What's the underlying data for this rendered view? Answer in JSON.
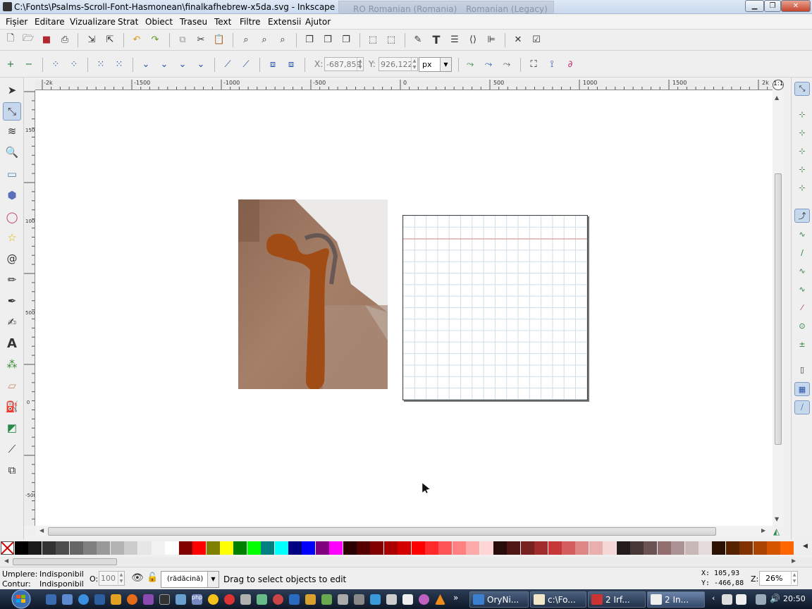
{
  "window": {
    "title": "C:\\Fonts\\Psalms-Scroll-Font-Hasmonean\\finalkafhebrew-x5da.svg - Inkscape",
    "lang_primary": "RO Romanian (Romania)",
    "lang_secondary": "Romanian (Legacy)",
    "minimize": "▁",
    "maximize": "❐",
    "close": "✕"
  },
  "menu": [
    "Fișier",
    "Editare",
    "Vizualizare",
    "Strat",
    "Obiect",
    "Traseu",
    "Text",
    "Filtre",
    "Extensii",
    "Ajutor"
  ],
  "node_toolbar": {
    "x_label": "X:",
    "x_value": "-687,859",
    "y_label": "Y:",
    "y_value": "926,122",
    "unit": "px"
  },
  "ruler_h": [
    "-2k",
    "-1500",
    "-1000",
    "-500",
    "0",
    "500",
    "1000",
    "1500",
    "2k"
  ],
  "ruler_v": [
    "1500",
    "1000",
    "500",
    "0",
    "-500"
  ],
  "palette_colors": [
    "#000000",
    "#1a1a1a",
    "#333333",
    "#4d4d4d",
    "#666666",
    "#808080",
    "#999999",
    "#b3b3b3",
    "#cccccc",
    "#e6e6e6",
    "#f2f2f2",
    "#ffffff",
    "#800000",
    "#ff0000",
    "#808000",
    "#ffff00",
    "#008000",
    "#00ff00",
    "#008080",
    "#00ffff",
    "#000080",
    "#0000ff",
    "#800080",
    "#ff00ff",
    "#2b0000",
    "#550000",
    "#800000",
    "#aa0000",
    "#d40000",
    "#ff0000",
    "#ff2a2a",
    "#ff5555",
    "#ff8080",
    "#ffaaaa",
    "#ffd5d5",
    "#280b0b",
    "#501616",
    "#782121",
    "#a02c2c",
    "#c83737",
    "#d35f5f",
    "#de8787",
    "#e9afaf",
    "#f4d7d7",
    "#241c1c",
    "#483737",
    "#6c5353",
    "#916f6f",
    "#ac9393",
    "#c8b7b7",
    "#e3dbdb",
    "#2b1100",
    "#552200",
    "#803300",
    "#aa4400",
    "#d45500",
    "#ff6600"
  ],
  "status": {
    "fill_label": "Umplere:",
    "fill_value": "Indisponibil",
    "stroke_label": "Contur:",
    "stroke_value": "Indisponibil",
    "opacity_label": "O:",
    "opacity_value": "100",
    "layer": "(rădăcină)",
    "message": "Drag to select objects to edit",
    "cursor_x": "X:  105,93",
    "cursor_y": "Y: -466,88",
    "zoom_label": "Z:",
    "zoom_value": "26%"
  },
  "taskbar": {
    "tasks": [
      "OryNi...",
      "c:\\Fo...",
      "2 Irf...",
      "2 In..."
    ],
    "time": "20:50"
  },
  "canvas": {
    "glyph_color": "#a14c15"
  }
}
